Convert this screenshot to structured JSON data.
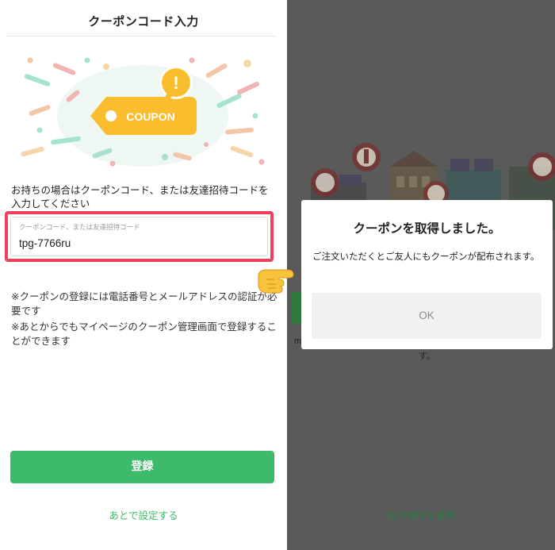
{
  "left_screen": {
    "header": {
      "title": "クーポンコード入力"
    },
    "illustration": {
      "tag_text": "COUPON",
      "alert_symbol": "!"
    },
    "description": "お持ちの場合はクーポンコード、または友達招待コードを入力してください",
    "code_input": {
      "placeholder": "クーポンコード、または友達招待コード",
      "value": "tpg-7766ru"
    },
    "notes": [
      "※クーポンの登録には電話番号とメールアドレスの認証が必要です",
      "※あとからでもマイページのクーポン管理画面で登録することができます"
    ],
    "register_button": "登録",
    "later_link": "あとで設定する"
  },
  "right_screen": {
    "background": {
      "m_text": "m",
      "su_text": "す。",
      "bottom_link": "他の場所を選択"
    },
    "dialog": {
      "title": "クーポンを取得しました。",
      "body": "ご注文いただくとご友人にもクーポンが配布されます。",
      "ok_button": "OK"
    }
  },
  "pointer_icon": "pointing-hand-emoji",
  "colors": {
    "accent_green": "#3dba6b",
    "highlight_red": "#f0405e",
    "coupon_yellow": "#f9bd2e",
    "overlay_gray": "#5a5a5a"
  }
}
